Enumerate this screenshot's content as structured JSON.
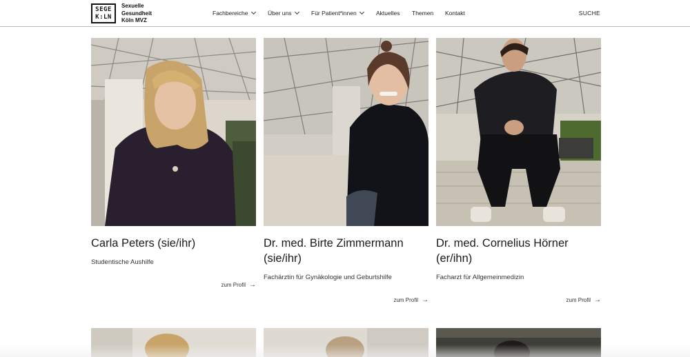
{
  "header": {
    "logo_line1": "SEGE",
    "logo_line2": "K:LN",
    "brand": [
      "Sexuelle",
      "Gesundheit",
      "Köln MVZ"
    ],
    "nav": [
      {
        "label": "Fachbereiche",
        "dropdown": true
      },
      {
        "label": "Über uns",
        "dropdown": true
      },
      {
        "label": "Für Patient*innen",
        "dropdown": true
      },
      {
        "label": "Aktuelles",
        "dropdown": false
      },
      {
        "label": "Themen",
        "dropdown": false
      },
      {
        "label": "Kontakt",
        "dropdown": false
      }
    ],
    "search_label": "SUCHE"
  },
  "cards": [
    {
      "name_line1": "Carla Peters (sie/ihr)",
      "name_line2": "",
      "role": "Studentische Aushilfe",
      "link": "zum Profil"
    },
    {
      "name_line1": "Dr. med. Birte Zimmermann",
      "name_line2": "(sie/ihr)",
      "role": "Fachärztin für Gynäkologie und Geburtshilfe",
      "link": "zum Profil"
    },
    {
      "name_line1": "Dr. med. Cornelius Hörner",
      "name_line2": "(er/ihn)",
      "role": "Facharzt für Allgemeinmedizin",
      "link": "zum Profil"
    }
  ],
  "icons": {
    "dropdown": "chevron-down-icon",
    "link_arrow": "arrow-right-icon"
  }
}
